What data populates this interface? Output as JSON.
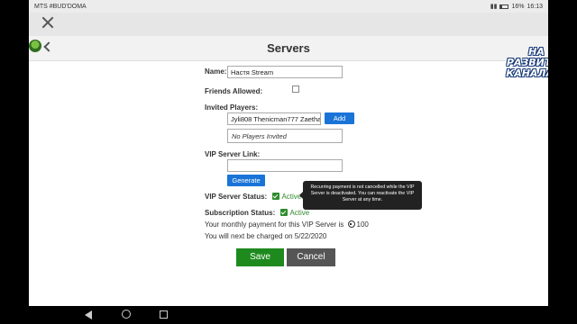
{
  "statusbar": {
    "carrier": "MTS #BUD'DOMA",
    "battery": "16%",
    "time": "16:13"
  },
  "header": {
    "title": "Servers"
  },
  "form": {
    "name_label": "Name:",
    "name_value": "Настя Stream",
    "friends_label": "Friends Allowed:",
    "invited_label": "Invited Players:",
    "invited_value": "Jyli808 Thenicman777 Zaethan",
    "add_button": "Add",
    "no_players": "No Players Invited",
    "link_label": "VIP Server Link:",
    "link_value": "",
    "generate_button": "Generate",
    "status_label": "VIP Server Status:",
    "status_value": "Active",
    "tooltip": "Recurring payment is not cancelled while the VIP Server is deactivated. You can reactivate the VIP Server at any time.",
    "subscription_label": "Subscription Status:",
    "subscription_value": "Active",
    "monthly_text": "Your monthly payment for this VIP Server is",
    "monthly_amount": "100",
    "charge_text": "You will next be charged on 5/22/2020"
  },
  "buttons": {
    "save": "Save",
    "cancel": "Cancel"
  },
  "watermark": {
    "line1": "НА",
    "line2": "РАЗВИТИЕ",
    "line3": "КАНАЛА_И"
  },
  "colors": {
    "accent_blue": "#1a74d8",
    "save_green": "#1e8a1e",
    "cancel_gray": "#555555",
    "active_green": "#2e8b2e"
  }
}
